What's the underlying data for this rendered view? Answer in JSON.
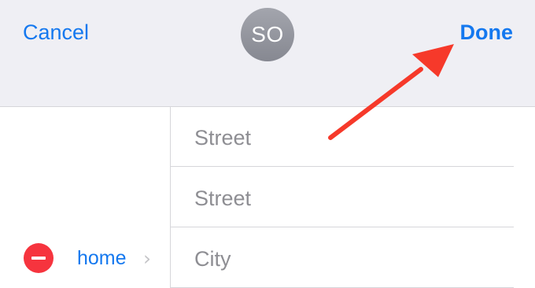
{
  "header": {
    "cancel_label": "Cancel",
    "done_label": "Done",
    "avatar_initials": "SO"
  },
  "address": {
    "type_label": "home",
    "street1_placeholder": "Street",
    "street2_placeholder": "Street",
    "city_placeholder": "City"
  },
  "colors": {
    "accent": "#1478ef",
    "delete": "#f6343e",
    "annotation_arrow": "#f6392a",
    "header_bg": "#efeff4"
  },
  "icons": [
    "remove-field-icon",
    "chevron-right-icon",
    "annotation-arrow"
  ]
}
